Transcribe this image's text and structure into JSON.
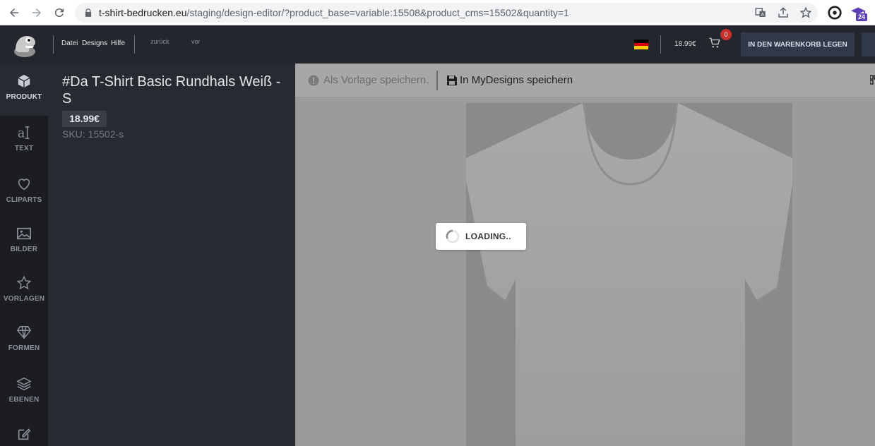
{
  "browser": {
    "url_host": "t-shirt-bedrucken.eu",
    "url_path": "/staging/design-editor/?product_base=variable:15508&product_cms=15502&quantity=1",
    "extension_badge": "24",
    "icons": [
      "back-icon",
      "forward-icon",
      "reload-icon",
      "lock-icon",
      "translate-icon",
      "share-icon",
      "star-icon",
      "extension-icon"
    ]
  },
  "header": {
    "menu": [
      "Datei",
      "Designs",
      "Hilfe"
    ],
    "undo_label": "zurück",
    "redo_label": "vor",
    "price": "18.99€",
    "cart_count": "0",
    "add_to_cart_label": "IN DEN WARENKORB LEGEN",
    "language": "de"
  },
  "sidebar": {
    "items": [
      {
        "label": "PRODUKT",
        "icon": "cube-icon",
        "active": true
      },
      {
        "label": "TEXT",
        "icon": "text-icon",
        "active": false
      },
      {
        "label": "CLIPARTS",
        "icon": "heart-icon",
        "active": false
      },
      {
        "label": "BILDER",
        "icon": "image-icon",
        "active": false
      },
      {
        "label": "VORLAGEN",
        "icon": "star-icon",
        "active": false
      },
      {
        "label": "FORMEN",
        "icon": "diamond-icon",
        "active": false
      },
      {
        "label": "EBENEN",
        "icon": "layers-icon",
        "active": false
      },
      {
        "label": "",
        "icon": "edit-icon",
        "active": false
      }
    ]
  },
  "product": {
    "title": "#Da T-Shirt Basic Rundhals Weiß - S",
    "price": "18.99€",
    "sku": "SKU: 15502-s"
  },
  "toolbar": {
    "save_template_label": "Als Vorlage speichern.",
    "save_mydesigns_label": "In MyDesigns speichern"
  },
  "canvas": {
    "loading_text": "LOADING.."
  },
  "colors": {
    "header_bg": "#23262d",
    "panel_bg": "#262a31",
    "rail_bg": "#1b1d22",
    "overlay_gray": "#9b9b9b",
    "cart_badge": "#c9302c"
  }
}
